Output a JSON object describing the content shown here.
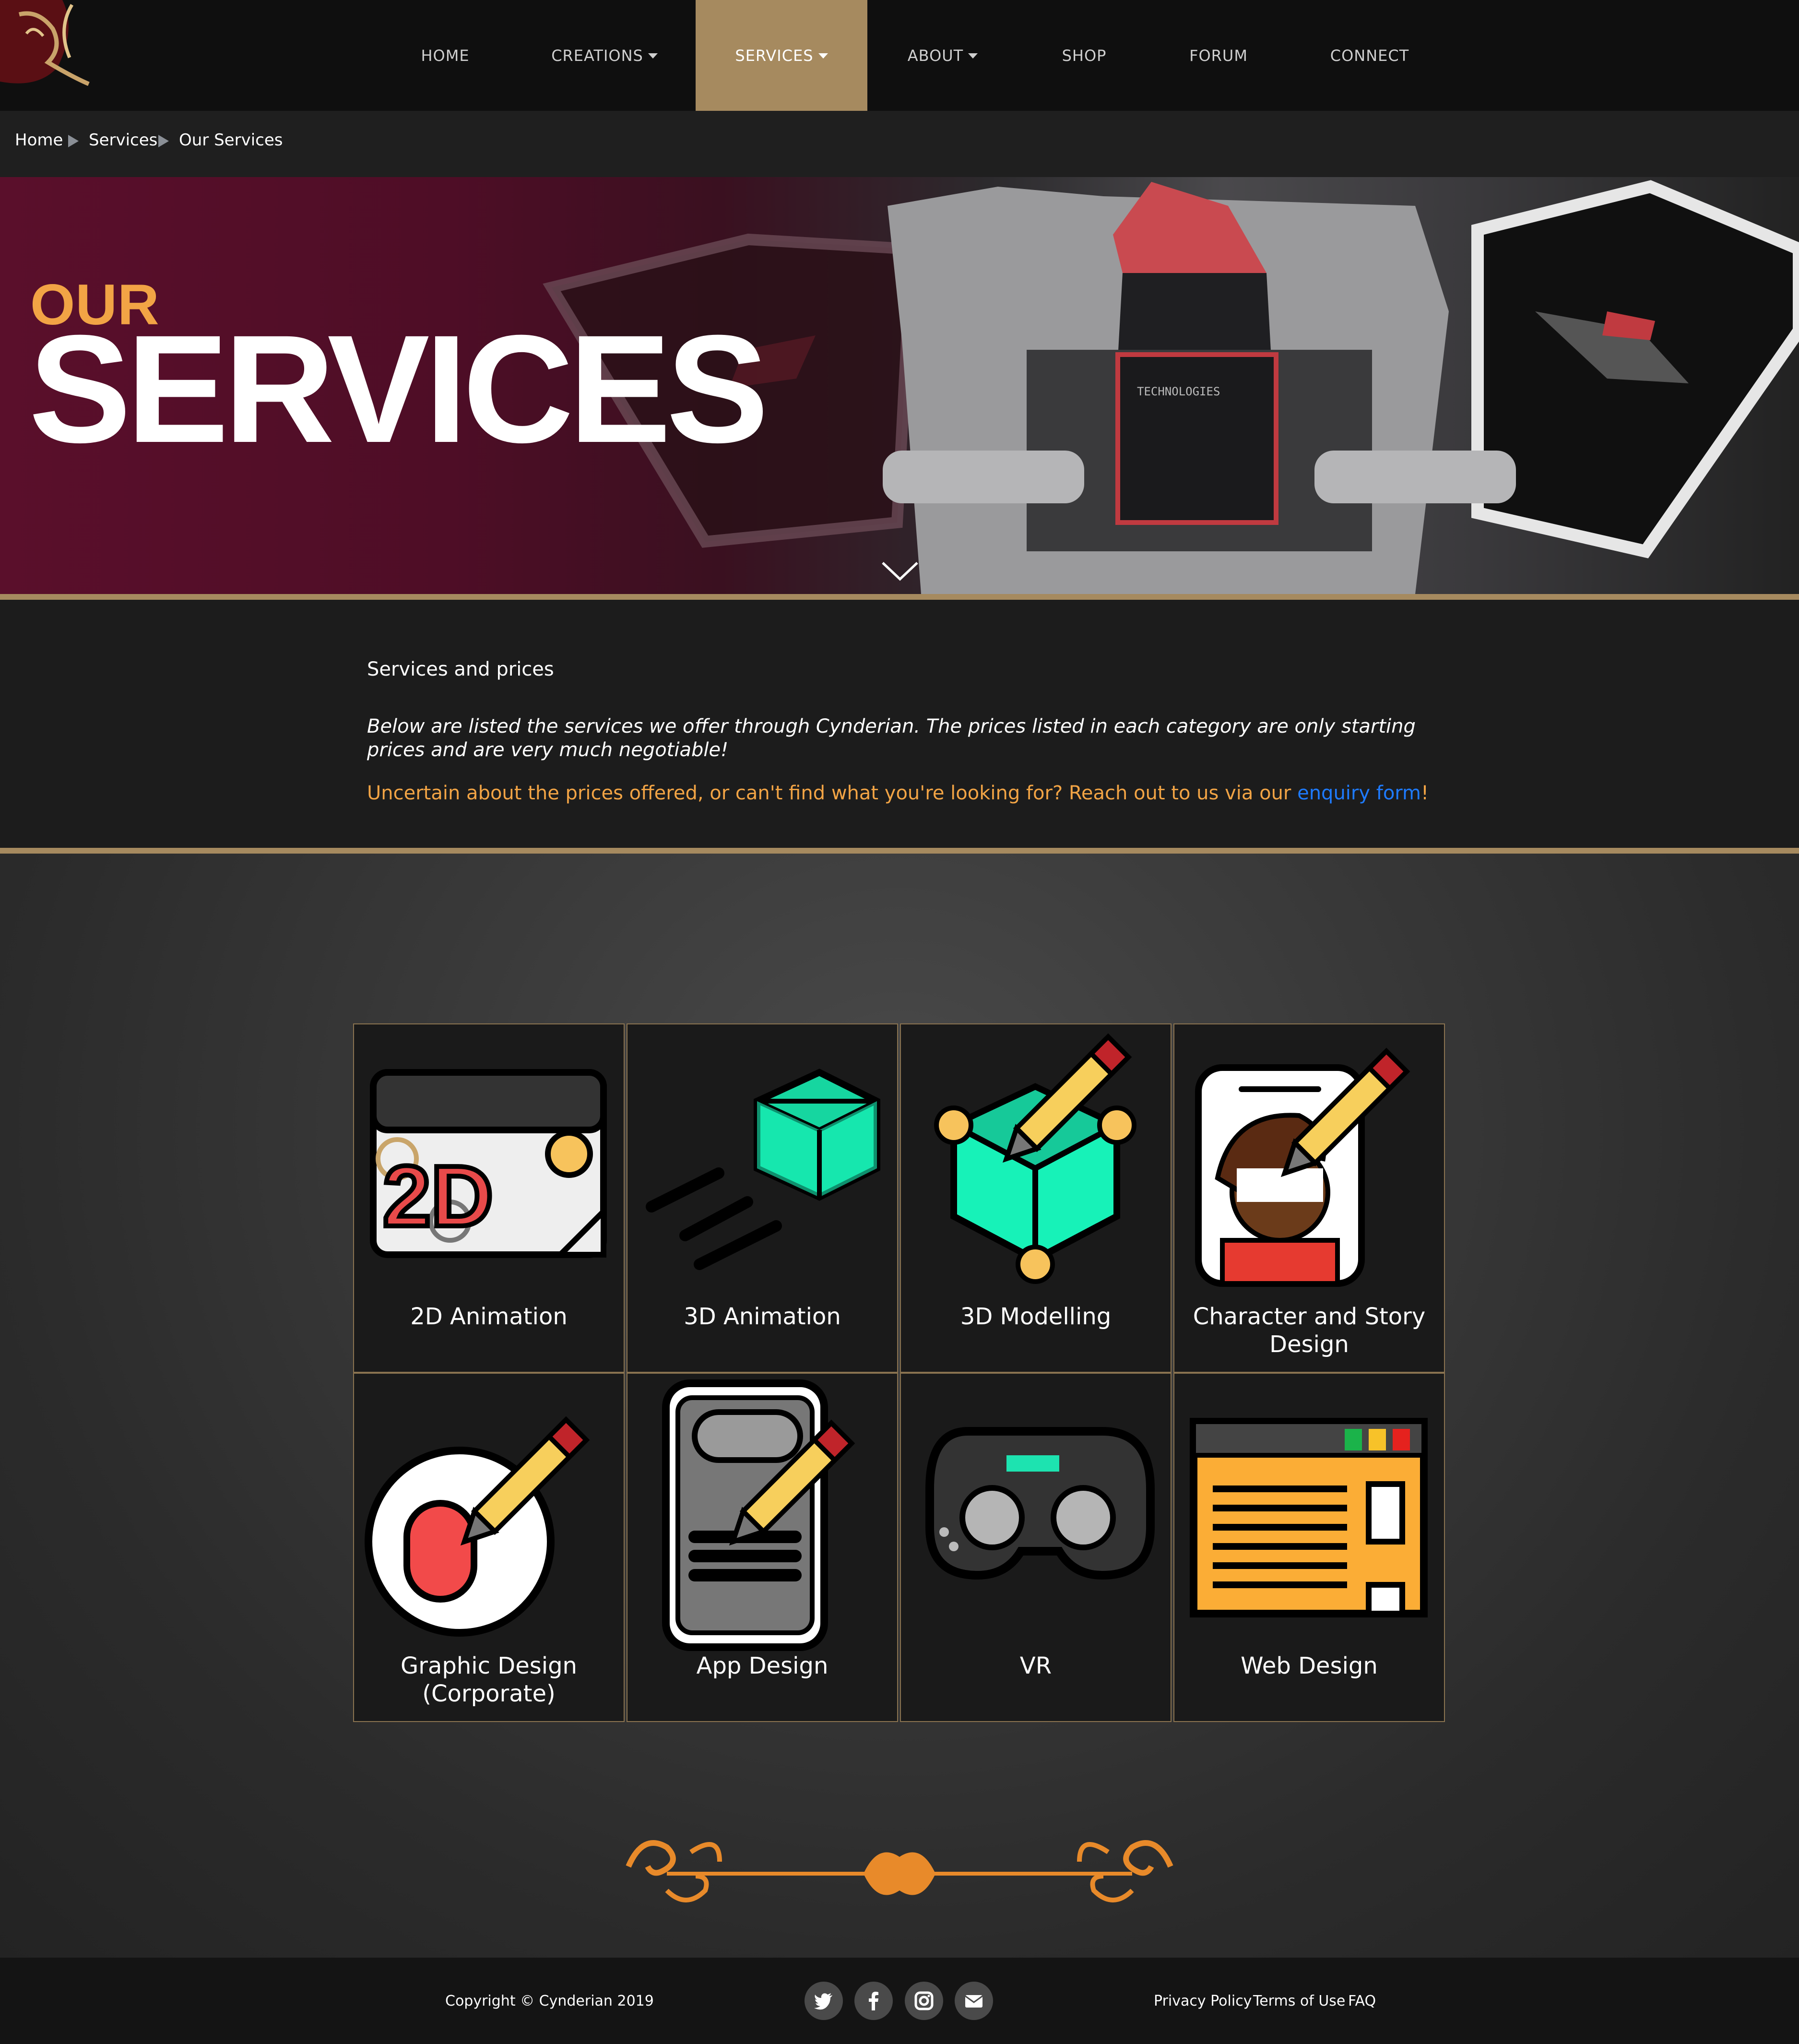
{
  "nav": {
    "items": [
      {
        "label": "HOME",
        "dropdown": false,
        "active": false
      },
      {
        "label": "CREATIONS",
        "dropdown": true,
        "active": false
      },
      {
        "label": "SERVICES",
        "dropdown": true,
        "active": true
      },
      {
        "label": "ABOUT",
        "dropdown": true,
        "active": false
      },
      {
        "label": "SHOP",
        "dropdown": false,
        "active": false
      },
      {
        "label": "FORUM",
        "dropdown": false,
        "active": false
      },
      {
        "label": "CONNECT",
        "dropdown": false,
        "active": false
      }
    ],
    "active_color": "#a68a5f"
  },
  "breadcrumb": [
    "Home",
    "Services",
    "Our Services"
  ],
  "hero": {
    "kicker": "OUR",
    "title": "SERVICES",
    "scroll_icon": "chevron-down-icon",
    "accent": "#f2a445",
    "bg": "#5a0f2b"
  },
  "intro": {
    "heading": "Services and prices",
    "paragraph": "Below are listed the services we offer through Cynderian. The prices listed in each category are only starting prices and are very much negotiable!",
    "cta_text": "Uncertain about the prices offered, or can't find what you're looking for? Reach out to us via our ",
    "cta_link": "enquiry form",
    "cta_end": "!"
  },
  "services": [
    {
      "label": "2D Animation",
      "icon": "2d-animation-icon"
    },
    {
      "label": "3D Animation",
      "icon": "3d-animation-icon"
    },
    {
      "label": "3D Modelling",
      "icon": "3d-modelling-icon"
    },
    {
      "label": "Character and Story Design",
      "icon": "character-design-icon"
    },
    {
      "label": "Graphic Design (Corporate)",
      "icon": "graphic-design-icon"
    },
    {
      "label": "App Design",
      "icon": "app-design-icon"
    },
    {
      "label": "VR",
      "icon": "vr-headset-icon"
    },
    {
      "label": "Web Design",
      "icon": "web-design-icon"
    }
  ],
  "footer": {
    "copyright": "Copyright © Cynderian 2019",
    "social": [
      "twitter-icon",
      "facebook-icon",
      "instagram-icon",
      "email-icon"
    ],
    "links": [
      "Privacy Policy",
      "Terms of Use",
      "FAQ"
    ]
  }
}
